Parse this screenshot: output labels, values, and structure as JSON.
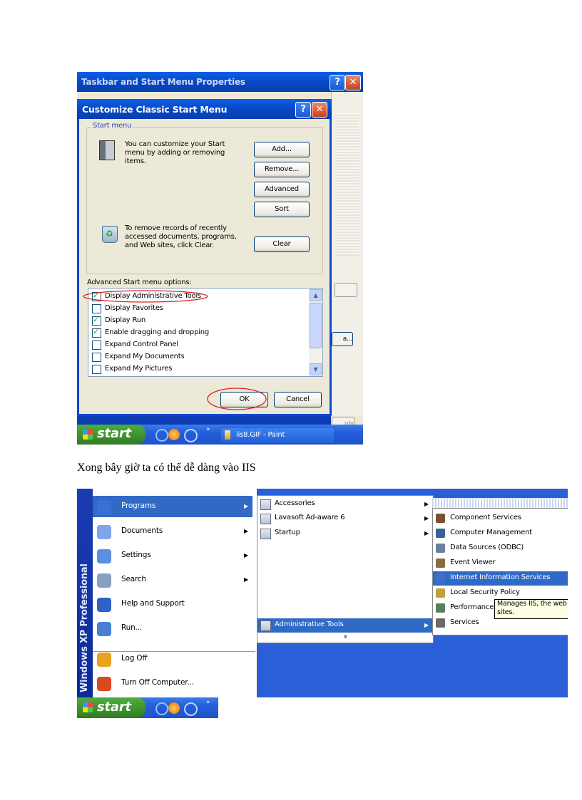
{
  "caption": "Xong bây giờ ta có thể dễ dàng vào IIS",
  "shot1": {
    "outer_title": "Taskbar and Start Menu Properties",
    "dialog_title": "Customize Classic Start Menu",
    "group_label": "Start menu",
    "customize_text": [
      "You can customize your Start",
      "menu by adding or removing",
      "items."
    ],
    "remove_text": [
      "To remove records of recently",
      "accessed documents, programs,",
      "and Web sites, click Clear."
    ],
    "buttons": {
      "add": "Add...",
      "remove": "Remove...",
      "advanced": "Advanced",
      "sort": "Sort",
      "clear": "Clear",
      "ok": "OK",
      "cancel": "Cancel"
    },
    "help_glyph": "?",
    "close_glyph": "✕",
    "advanced_label": "Advanced Start menu options:",
    "options": [
      {
        "label": "Display Administrative Tools",
        "checked": true
      },
      {
        "label": "Display Favorites",
        "checked": false
      },
      {
        "label": "Display Run",
        "checked": true
      },
      {
        "label": "Enable dragging and dropping",
        "checked": true
      },
      {
        "label": "Expand Control Panel",
        "checked": false
      },
      {
        "label": "Expand My Documents",
        "checked": false
      },
      {
        "label": "Expand My Pictures",
        "checked": false
      }
    ],
    "scroll_up": "▲",
    "scroll_down": "▼",
    "taskbar_start": "start",
    "taskbar_task": "iis8.GIF - Paint",
    "taskbar_chevron": "»",
    "side_fragment_a": "a...",
    "side_fragment_b": "ply"
  },
  "shot2": {
    "side_banner": "Windows XP Professional",
    "start_items": [
      {
        "label": "Programs",
        "icon": "programs-icon",
        "arrow": true,
        "highlight": true
      },
      {
        "label": "Documents",
        "icon": "documents-icon",
        "arrow": true
      },
      {
        "label": "Settings",
        "icon": "settings-icon",
        "arrow": true
      },
      {
        "label": "Search",
        "icon": "search-icon",
        "arrow": true
      },
      {
        "label": "Help and Support",
        "icon": "help-icon",
        "arrow": false
      },
      {
        "label": "Run...",
        "icon": "run-icon",
        "arrow": false
      },
      {
        "label": "Log Off",
        "icon": "logoff-icon",
        "arrow": false
      },
      {
        "label": "Turn Off Computer...",
        "icon": "power-icon",
        "arrow": false
      }
    ],
    "programs_items": [
      {
        "label": "Accessories",
        "arrow": true
      },
      {
        "label": "Lavasoft Ad-aware 6",
        "arrow": true
      },
      {
        "label": "Startup",
        "arrow": true
      },
      {
        "label": "Administrative Tools",
        "arrow": true,
        "highlight": true
      }
    ],
    "more_chevron": "»",
    "admin_items": [
      {
        "label": "Component Services"
      },
      {
        "label": "Computer Management"
      },
      {
        "label": "Data Sources (ODBC)"
      },
      {
        "label": "Event Viewer"
      },
      {
        "label": "Internet Information Services",
        "highlight": true
      },
      {
        "label": "Local Security Policy"
      },
      {
        "label": "Performance"
      },
      {
        "label": "Services"
      }
    ],
    "tooltip": [
      "Manages IIS, the web",
      "sites."
    ],
    "taskbar_start": "start",
    "taskbar_chevron": "»"
  },
  "colors": {
    "xp_blue": "#245edb",
    "menu_highlight": "#316ac5",
    "start_green": "#3c8f2d",
    "annotation_red": "#e02020"
  }
}
